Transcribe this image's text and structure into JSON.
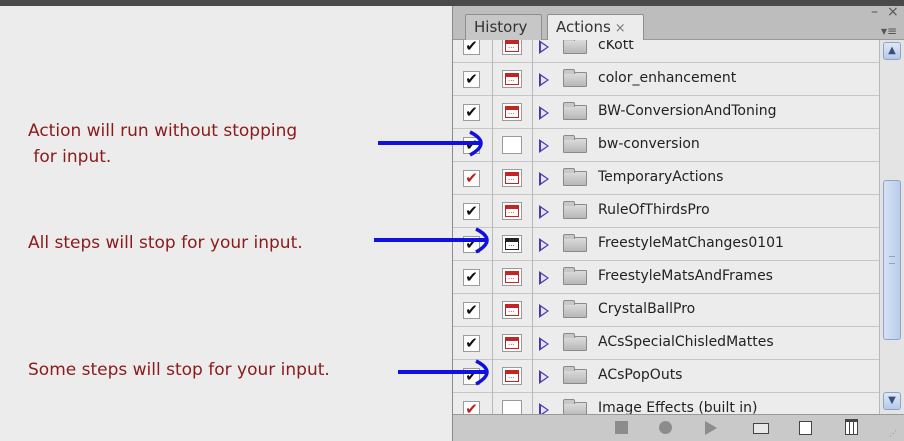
{
  "annotations": {
    "run_without_stopping": "Action will run without stopping\n for input.",
    "all_steps_stop": "All steps will stop for your input.",
    "some_steps_stop": "Some steps will stop for your input."
  },
  "panel": {
    "tabs": [
      {
        "label": "History"
      },
      {
        "label": "Actions",
        "close": "×"
      }
    ],
    "window_controls": {
      "minimize": "–",
      "close": "×"
    },
    "menu_icon": "menu-lines-icon"
  },
  "actions": [
    {
      "label": "cKott",
      "check": "black",
      "dialog": "red"
    },
    {
      "label": "color_enhancement",
      "check": "black",
      "dialog": "red"
    },
    {
      "label": "BW-ConversionAndToning",
      "check": "black",
      "dialog": "red"
    },
    {
      "label": "bw-conversion",
      "check": "black",
      "dialog": "empty"
    },
    {
      "label": "TemporaryActions",
      "check": "red",
      "dialog": "red"
    },
    {
      "label": "RuleOfThirdsPro",
      "check": "black",
      "dialog": "red"
    },
    {
      "label": "FreestyleMatChanges0101",
      "check": "black",
      "dialog": "black"
    },
    {
      "label": "FreestyleMatsAndFrames",
      "check": "black",
      "dialog": "red"
    },
    {
      "label": "CrystalBallPro",
      "check": "black",
      "dialog": "red"
    },
    {
      "label": "ACsSpecialChisledMattes",
      "check": "black",
      "dialog": "red"
    },
    {
      "label": "ACsPopOuts",
      "check": "black",
      "dialog": "red"
    },
    {
      "label": "Image Effects (built in)",
      "check": "red",
      "dialog": "empty"
    }
  ],
  "colors": {
    "annotation_text": "#8b1a1a",
    "arrow": "#1010e0",
    "check_black": "#111111",
    "check_red": "#c41a1a"
  },
  "bottom_toolbar": [
    "stop-icon",
    "record-icon",
    "play-icon",
    "new-set-icon",
    "new-action-icon",
    "trash-icon"
  ]
}
